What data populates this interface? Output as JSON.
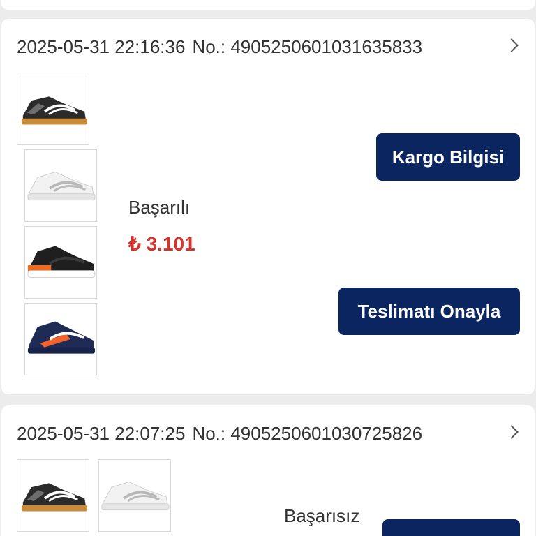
{
  "orders": [
    {
      "date": "2025-05-31 22:16:36",
      "order_no": "No.: 4905250601031635833",
      "status": "Başarılı",
      "price": "₺ 3.101",
      "buttons": {
        "shipping": "Kargo Bilgisi",
        "confirm": "Teslimatı Onayla"
      },
      "products": [
        {
          "icon": "shoe-black-gum-sole"
        },
        {
          "icon": "shoe-white-grey"
        },
        {
          "icon": "shoe-black-orange"
        },
        {
          "icon": "shoe-navy-orange"
        }
      ]
    },
    {
      "date": "2025-05-31 22:07:25",
      "order_no": "No.: 4905250601030725826",
      "status": "Başarısız",
      "products": [
        {
          "icon": "shoe-black-gum-sole"
        },
        {
          "icon": "shoe-white-grey"
        }
      ]
    }
  ],
  "colors": {
    "accent": "#0b2560",
    "price": "#d8322a",
    "background": "#ececec"
  }
}
